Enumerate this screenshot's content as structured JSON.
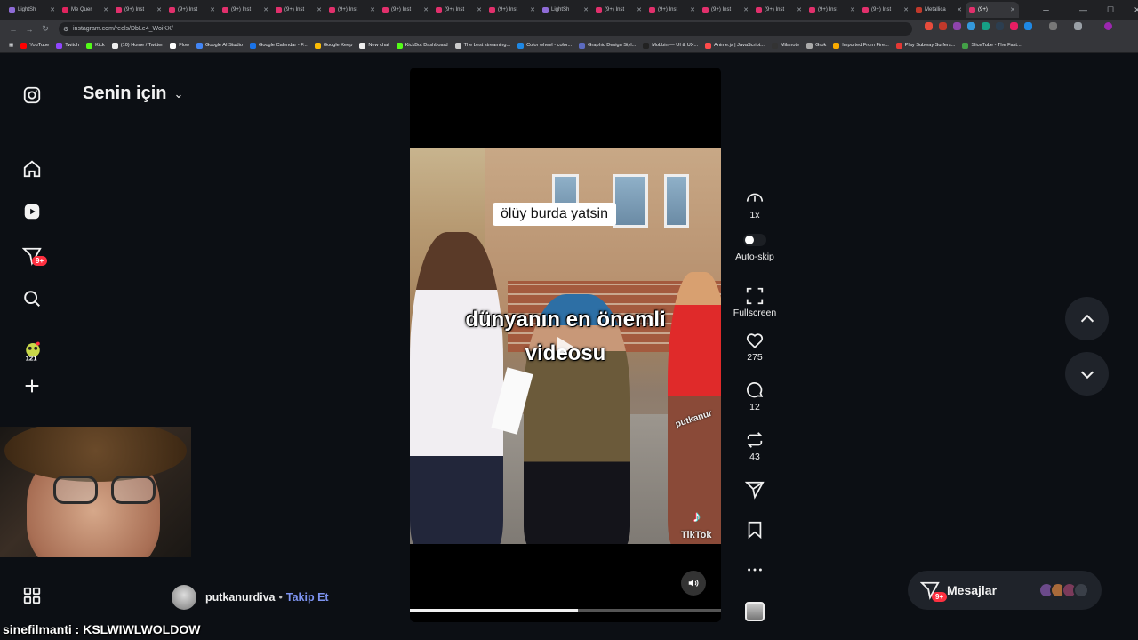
{
  "browser": {
    "tabs": [
      {
        "label": "LightSh",
        "color": "#8e6bd6"
      },
      {
        "label": "Me Quer",
        "color": "#e0245e"
      },
      {
        "label": "(9+) Inst",
        "color": "#e1306c"
      },
      {
        "label": "(9+) Inst",
        "color": "#e1306c"
      },
      {
        "label": "(9+) Inst",
        "color": "#e1306c"
      },
      {
        "label": "(9+) Inst",
        "color": "#e1306c"
      },
      {
        "label": "(9+) Inst",
        "color": "#e1306c"
      },
      {
        "label": "(9+) Inst",
        "color": "#e1306c"
      },
      {
        "label": "(9+) Inst",
        "color": "#e1306c"
      },
      {
        "label": "(9+) Inst",
        "color": "#e1306c"
      },
      {
        "label": "LightSh",
        "color": "#8e6bd6"
      },
      {
        "label": "(9+) Inst",
        "color": "#e1306c"
      },
      {
        "label": "(9+) Inst",
        "color": "#e1306c"
      },
      {
        "label": "(9+) Inst",
        "color": "#e1306c"
      },
      {
        "label": "(9+) Inst",
        "color": "#e1306c"
      },
      {
        "label": "(9+) Inst",
        "color": "#e1306c"
      },
      {
        "label": "(9+) Inst",
        "color": "#e1306c"
      },
      {
        "label": "Metallica",
        "color": "#c0392b"
      },
      {
        "label": "(9+) I",
        "color": "#e1306c",
        "active": true
      }
    ],
    "url": "instagram.com/reels/DbLe4_WoiKX/",
    "bookmarks": [
      {
        "label": "YouTube",
        "color": "#ff0000"
      },
      {
        "label": "Twitch",
        "color": "#9146ff"
      },
      {
        "label": "Kick",
        "color": "#53fc18"
      },
      {
        "label": "(10) Home / Twitter",
        "color": "#eeeeee"
      },
      {
        "label": "Flow",
        "color": "#ffffff"
      },
      {
        "label": "Google AI Studio",
        "color": "#4285f4"
      },
      {
        "label": "Google Calendar - F...",
        "color": "#1a73e8"
      },
      {
        "label": "Google Keep",
        "color": "#fbbc04"
      },
      {
        "label": "New chat",
        "color": "#eeeeee"
      },
      {
        "label": "KickBot Dashboard",
        "color": "#53fc18"
      },
      {
        "label": "The best streaming...",
        "color": "#cccccc"
      },
      {
        "label": "Color wheel - color...",
        "color": "#1e88e5"
      },
      {
        "label": "Graphic Design Styl...",
        "color": "#5c6bc0"
      },
      {
        "label": "Mobbin — UI & UX...",
        "color": "#222222"
      },
      {
        "label": "Anime.js | JavaScript...",
        "color": "#ff4b4b"
      },
      {
        "label": "Milanote",
        "color": "#333333"
      },
      {
        "label": "Grok",
        "color": "#aaaaaa"
      },
      {
        "label": "Imported From Fire...",
        "color": "#f9ab00"
      },
      {
        "label": "Play Subway Surfers...",
        "color": "#e53935"
      },
      {
        "label": "SliceTube - The Fast...",
        "color": "#43a047"
      }
    ]
  },
  "sidebar": {
    "header_title": "Senin için",
    "notification_badge": "9+",
    "icons": [
      "instagram-icon",
      "home-icon",
      "reels-icon",
      "direct-icon",
      "search-icon",
      "create-icon",
      "more-icon"
    ]
  },
  "video": {
    "caption_top": "ölüy burda yatsin",
    "caption_line1": "dünyanın en önemli",
    "caption_line2": "videosu",
    "watermark_user": "putkanur",
    "watermark_brand": "TikTok",
    "progress": 0.54
  },
  "actions": {
    "speed_label": "1x",
    "autoskip_label": "Auto-skip",
    "fullscreen_label": "Fullscreen",
    "likes": "275",
    "comments": "12",
    "reposts": "43"
  },
  "author": {
    "username": "putkanurdiva",
    "separator": "•",
    "follow_label": "Takip Et"
  },
  "messages": {
    "label": "Mesajlar",
    "badge": "9+"
  },
  "overlay": {
    "chat_user": "sinefilmanti",
    "chat_text": " : KSLWIWLWOLDOW"
  }
}
